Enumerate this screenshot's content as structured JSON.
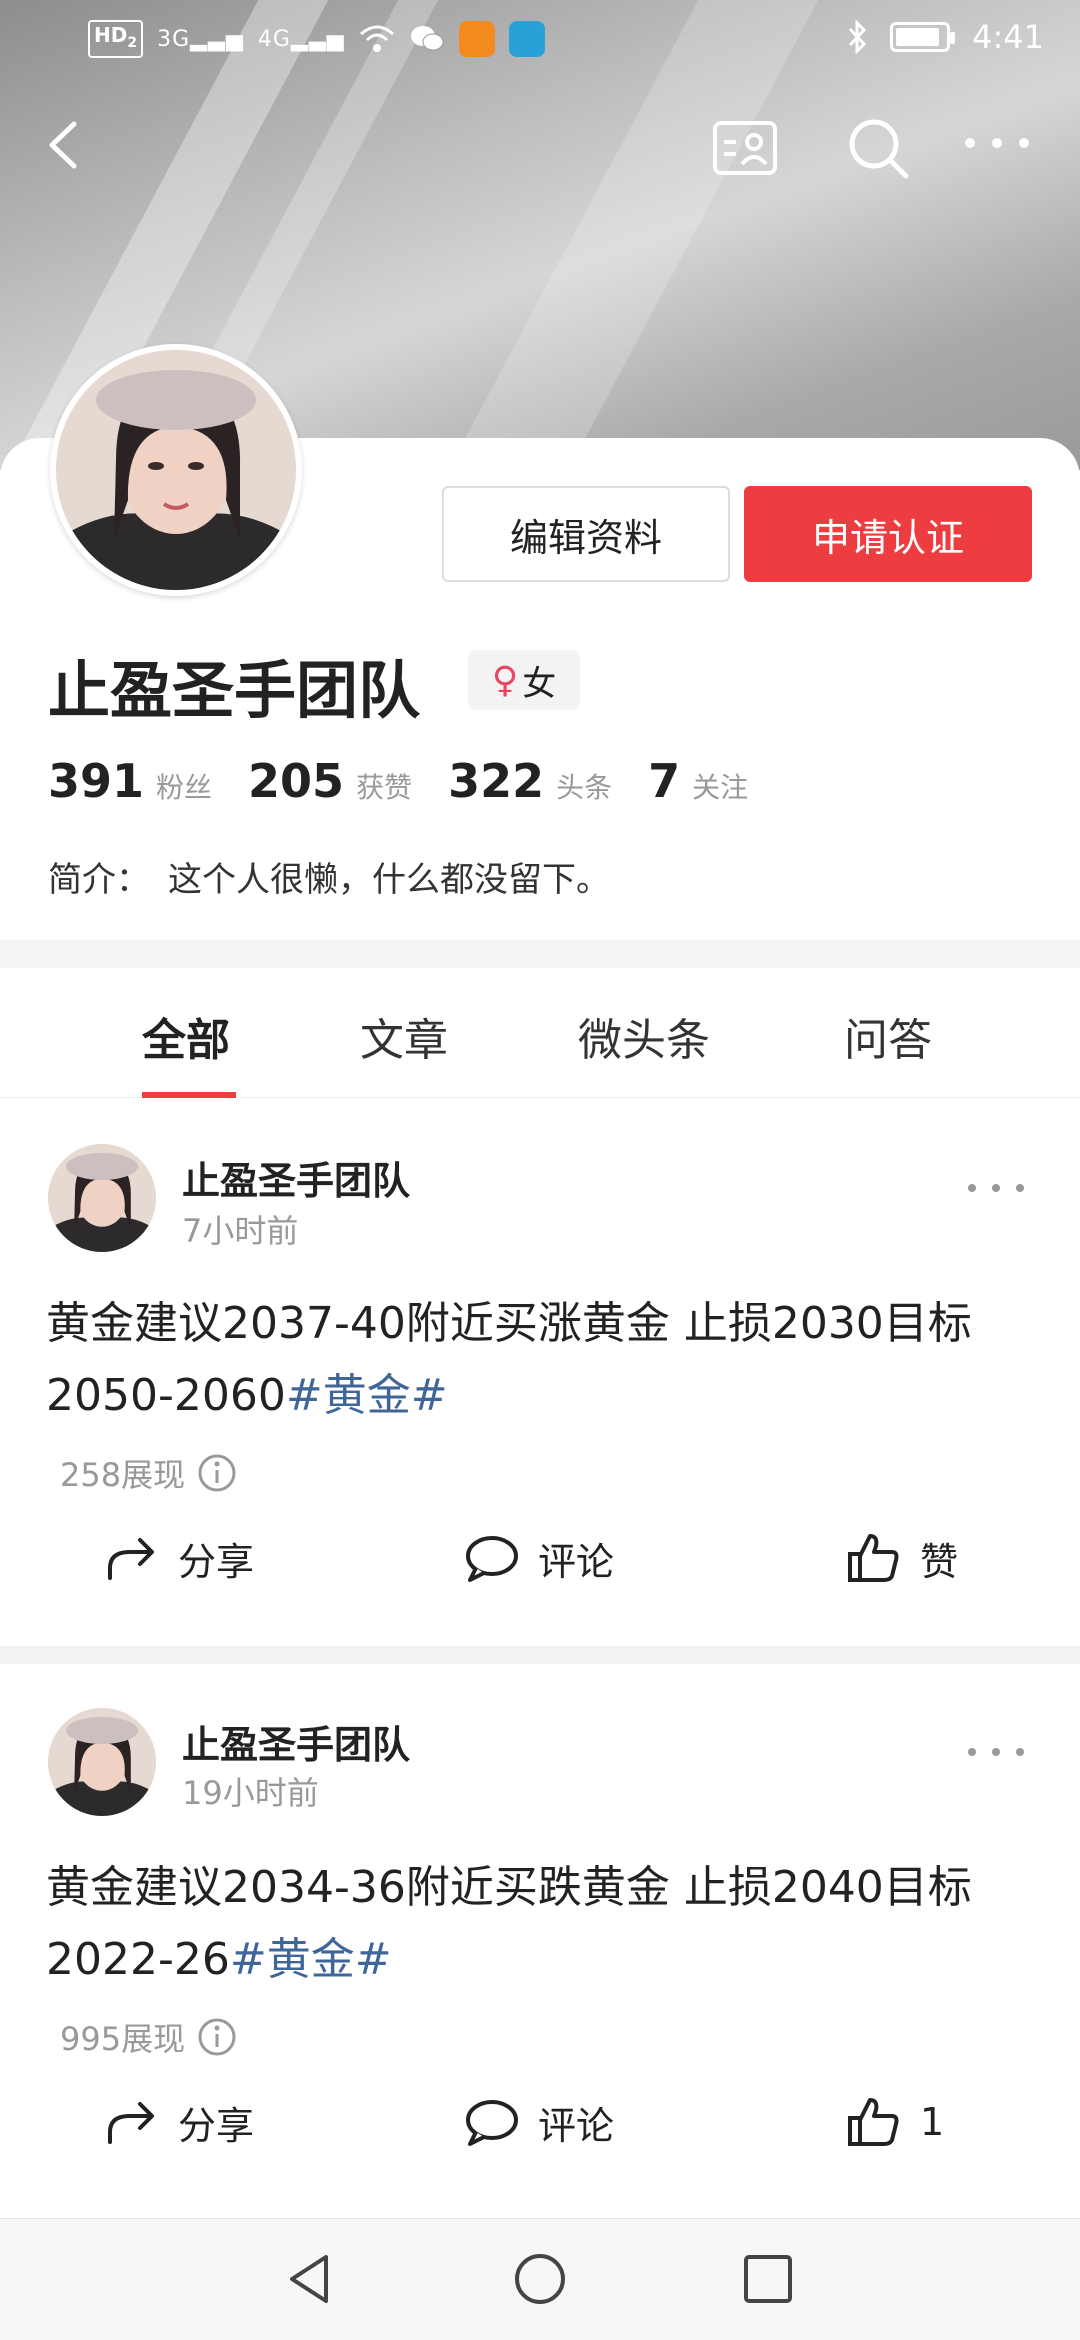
{
  "status_bar": {
    "hd_label": "HD",
    "hd_sub": "2",
    "signal1": "3G",
    "signal2": "4G",
    "time": "4:41"
  },
  "profile": {
    "name": "止盈圣手团队",
    "gender_symbol": "♀",
    "gender": "女",
    "edit_button": "编辑资料",
    "verify_button": "申请认证",
    "stats": [
      {
        "num": "391",
        "label": "粉丝"
      },
      {
        "num": "205",
        "label": "获赞"
      },
      {
        "num": "322",
        "label": "头条"
      },
      {
        "num": "7",
        "label": "关注"
      }
    ],
    "bio_label": "简介：",
    "bio_text": "这个人很懒，什么都没留下。"
  },
  "tabs": [
    "全部",
    "文章",
    "微头条",
    "问答"
  ],
  "posts": [
    {
      "author": "止盈圣手团队",
      "time": "7小时前",
      "text": "黄金建议2037-40附近买涨黄金 止损2030目标2050-2060",
      "tag": "#黄金#",
      "views": "258展现",
      "share": "分享",
      "comment": "评论",
      "like": "赞"
    },
    {
      "author": "止盈圣手团队",
      "time": "19小时前",
      "text": "黄金建议2034-36附近买跌黄金 止损2040目标2022-26",
      "tag": "#黄金#",
      "views": "995展现",
      "share": "分享",
      "comment": "评论",
      "like": "1"
    }
  ],
  "colors": {
    "accent": "#ee3d40",
    "tag": "#406599",
    "gender": "#e8485f"
  },
  "battery_level": 0.9
}
